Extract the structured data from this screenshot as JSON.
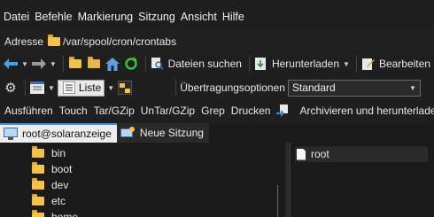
{
  "menu": [
    "Datei",
    "Befehle",
    "Markierung",
    "Sitzung",
    "Ansicht",
    "Hilfe"
  ],
  "address": {
    "label": "Adresse",
    "path": "/var/spool/cron/crontabs"
  },
  "toolbar1": {
    "find_files": "Dateien suchen",
    "download": "Herunterladen",
    "edit": "Bearbeiten"
  },
  "toolbar2": {
    "view_mode": "Liste",
    "transfer_label": "Übertragungsoptionen",
    "transfer_value": "Standard"
  },
  "toolbar3": [
    "Ausführen",
    "Touch",
    "Tar/GZip",
    "UnTar/GZip",
    "Grep",
    "Drucken"
  ],
  "toolbar3_extra": "Archivieren und herunterladen",
  "tabs": {
    "active": "root@solaranzeige",
    "new": "Neue Sitzung"
  },
  "tree": [
    "bin",
    "boot",
    "dev",
    "etc",
    "home"
  ],
  "files": [
    "root"
  ],
  "colors": {
    "folder": "#f2c14e",
    "tab_accent": "#3b8ad8",
    "background": "#1f1f1f"
  },
  "icons": [
    "back-arrow-icon",
    "forward-arrow-icon",
    "parent-folder-icon",
    "root-folder-icon",
    "home-icon",
    "refresh-icon",
    "find-icon",
    "download-icon",
    "edit-icon",
    "settings-icon",
    "view-icon",
    "list-icon",
    "filter-icon",
    "terminal-icon",
    "new-session-icon"
  ]
}
